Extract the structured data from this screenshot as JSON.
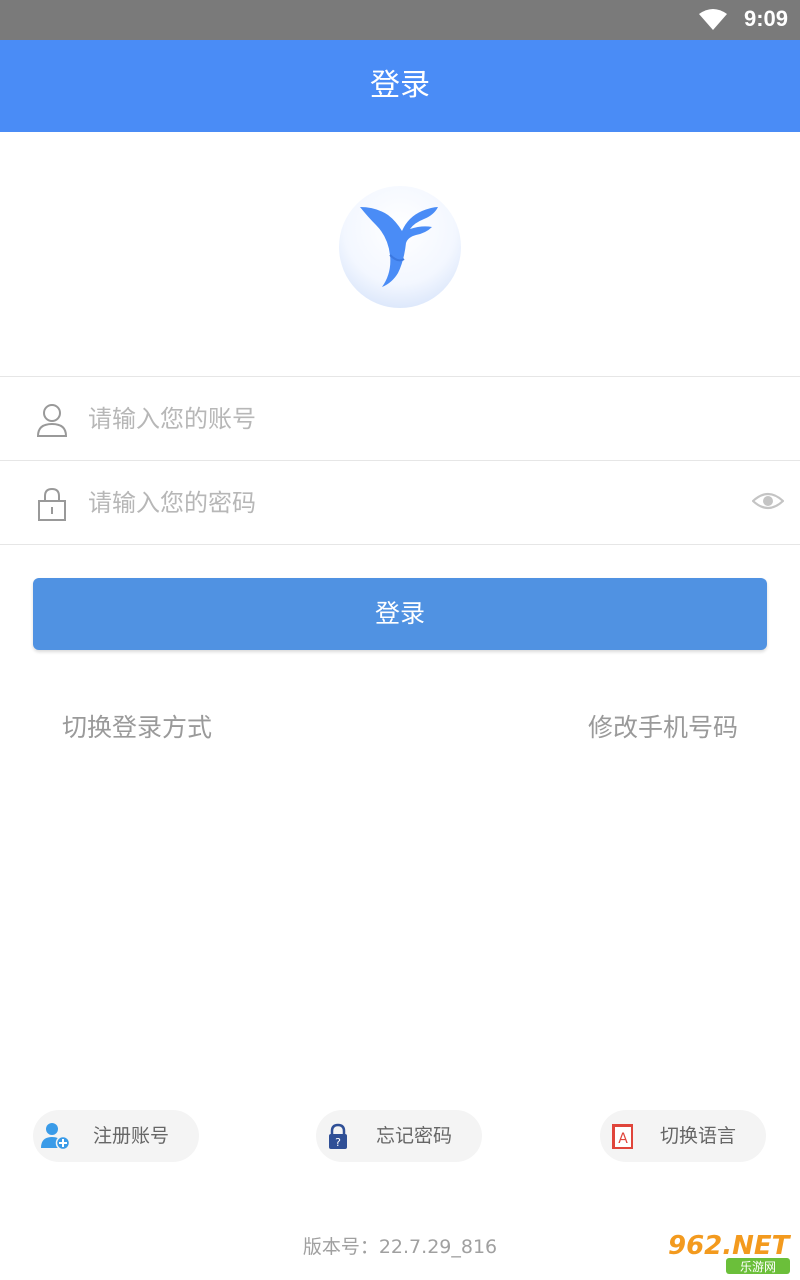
{
  "status_bar": {
    "time": "9:09",
    "wifi_icon": "wifi-icon"
  },
  "header": {
    "title": "登录",
    "color": "#4a8cf6"
  },
  "logo": {
    "icon": "feather-bird-logo"
  },
  "form": {
    "account": {
      "placeholder": "请输入您的账号",
      "value": "",
      "icon": "user-icon"
    },
    "password": {
      "placeholder": "请输入您的密码",
      "value": "",
      "icon": "lock-icon",
      "toggle_icon": "eye-icon"
    },
    "login_label": "登录",
    "login_color": "#5092e2"
  },
  "links": {
    "switch_login": "切换登录方式",
    "change_phone": "修改手机号码"
  },
  "bottom_actions": [
    {
      "label": "注册账号",
      "icon": "add-user-icon"
    },
    {
      "label": "忘记密码",
      "icon": "padlock-question-icon"
    },
    {
      "label": "切换语言",
      "icon": "language-book-icon"
    }
  ],
  "version": "版本号：22.7.29_816",
  "watermark": {
    "brand": "962.NET",
    "sub": "乐游网"
  }
}
